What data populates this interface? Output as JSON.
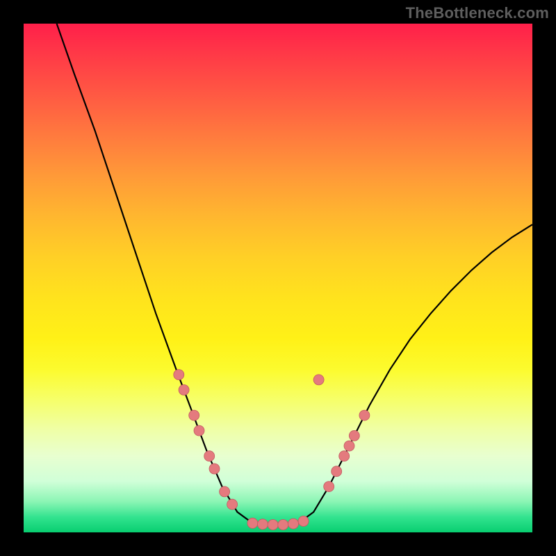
{
  "watermark": "TheBottleneck.com",
  "colors": {
    "curve_stroke": "#000000",
    "dot_fill": "#e47a7e",
    "dot_stroke": "#c25a60",
    "background": "#000000"
  },
  "chart_data": {
    "type": "line",
    "title": "",
    "xlabel": "",
    "ylabel": "",
    "xlim": [
      0,
      100
    ],
    "ylim": [
      0,
      100
    ],
    "grid": false,
    "legend": false,
    "description": "V-shaped bottleneck curve over a vertical rainbow gradient background (red at top through yellow to green at bottom). The curve descends steeply from top-left, flattens near the bottom center, then rises toward the right. Salmon-colored dots are scattered along the lower portion of both branches and along the flat bottom.",
    "series": [
      {
        "name": "curve",
        "points": [
          {
            "x": 6.5,
            "y": 100
          },
          {
            "x": 10,
            "y": 90
          },
          {
            "x": 14,
            "y": 79
          },
          {
            "x": 18,
            "y": 67
          },
          {
            "x": 22,
            "y": 55
          },
          {
            "x": 26,
            "y": 43
          },
          {
            "x": 30,
            "y": 32
          },
          {
            "x": 33,
            "y": 24
          },
          {
            "x": 36,
            "y": 16
          },
          {
            "x": 39,
            "y": 9
          },
          {
            "x": 42,
            "y": 4
          },
          {
            "x": 45,
            "y": 1.8
          },
          {
            "x": 48,
            "y": 1.5
          },
          {
            "x": 51,
            "y": 1.5
          },
          {
            "x": 54,
            "y": 1.8
          },
          {
            "x": 57,
            "y": 4
          },
          {
            "x": 60,
            "y": 9
          },
          {
            "x": 64,
            "y": 17
          },
          {
            "x": 68,
            "y": 25
          },
          {
            "x": 72,
            "y": 32
          },
          {
            "x": 76,
            "y": 38
          },
          {
            "x": 80,
            "y": 43
          },
          {
            "x": 84,
            "y": 47.5
          },
          {
            "x": 88,
            "y": 51.5
          },
          {
            "x": 92,
            "y": 55
          },
          {
            "x": 96,
            "y": 58
          },
          {
            "x": 100,
            "y": 60.5
          }
        ]
      }
    ],
    "dots": [
      {
        "x": 30.5,
        "y": 31
      },
      {
        "x": 31.5,
        "y": 28
      },
      {
        "x": 33.5,
        "y": 23
      },
      {
        "x": 34.5,
        "y": 20
      },
      {
        "x": 36.5,
        "y": 15
      },
      {
        "x": 37.5,
        "y": 12.5
      },
      {
        "x": 39.5,
        "y": 8
      },
      {
        "x": 41,
        "y": 5.5
      },
      {
        "x": 45,
        "y": 1.8
      },
      {
        "x": 47,
        "y": 1.6
      },
      {
        "x": 49,
        "y": 1.5
      },
      {
        "x": 51,
        "y": 1.5
      },
      {
        "x": 53,
        "y": 1.7
      },
      {
        "x": 55,
        "y": 2.2
      },
      {
        "x": 60,
        "y": 9
      },
      {
        "x": 61.5,
        "y": 12
      },
      {
        "x": 63,
        "y": 15
      },
      {
        "x": 64,
        "y": 17
      },
      {
        "x": 65,
        "y": 19
      },
      {
        "x": 67,
        "y": 23
      },
      {
        "x": 58,
        "y": 30
      }
    ]
  }
}
